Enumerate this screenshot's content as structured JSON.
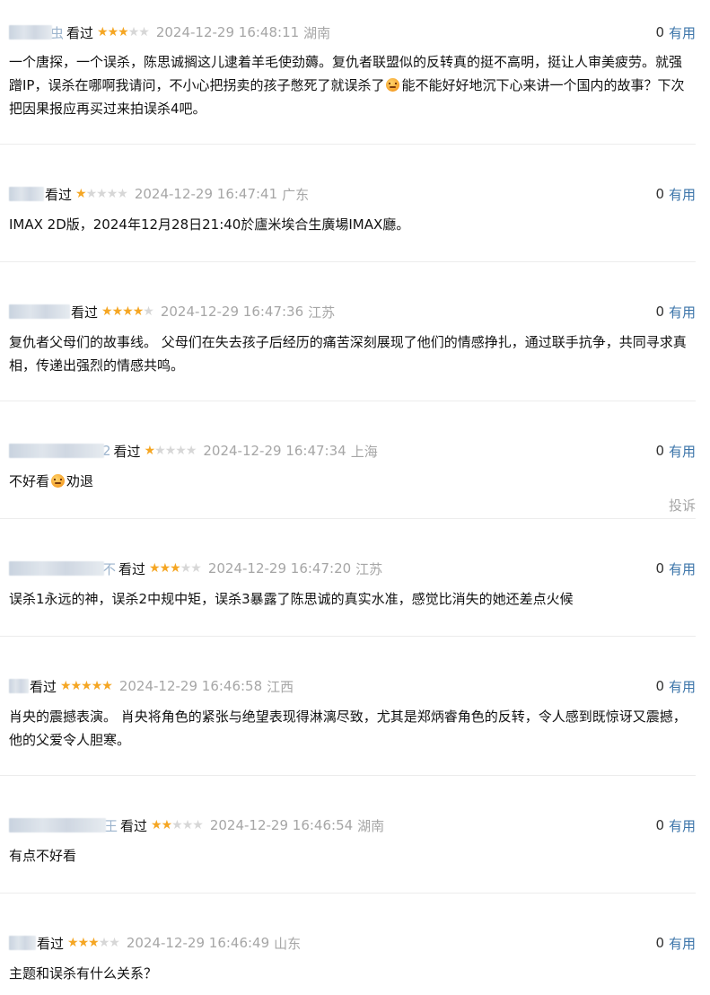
{
  "colors": {
    "star_on": "#f5a623",
    "star_off": "#d7d7d7",
    "meta_gray": "#a6a6a6",
    "link_blue": "#3b74a9",
    "divider": "#ececec"
  },
  "labels": {
    "watched": "看过",
    "useful": "有用",
    "report": "投诉"
  },
  "comments": [
    {
      "user_visible": "虫",
      "rating": 3,
      "time": "2024-12-29 16:48:11",
      "location": "湖南",
      "votes": "0",
      "text_parts": [
        "一个唐探，一个误杀，陈思诚搁这儿逮着羊毛使劲薅。复仇者联盟似的反转真的挺不高明，挺让人审美疲劳。就强蹭IP，误杀在哪啊我请问，不小心把拐卖的孩子憋死了就误杀了",
        "能不能好好地沉下心来讲一个国内的故事？下次把因果报应再买过来拍误杀4吧。"
      ]
    },
    {
      "user_visible": "",
      "rating": 1,
      "time": "2024-12-29 16:47:41",
      "location": "广东",
      "votes": "0",
      "text_parts": [
        "IMAX 2D版，2024年12月28日21:40於廬米埃合生廣場IMAX廳。"
      ]
    },
    {
      "user_visible": "",
      "rating": 4,
      "time": "2024-12-29 16:47:36",
      "location": "江苏",
      "votes": "0",
      "text_parts": [
        "复仇者父母们的故事线。 父母们在失去孩子后经历的痛苦深刻展现了他们的情感挣扎，通过联手抗争，共同寻求真相，传递出强烈的情感共鸣。"
      ]
    },
    {
      "user_visible": "2",
      "rating": 1,
      "time": "2024-12-29 16:47:34",
      "location": "上海",
      "votes": "0",
      "text_parts": [
        "不好看",
        "劝退"
      ]
    },
    {
      "user_visible": "不",
      "rating": 3,
      "time": "2024-12-29 16:47:20",
      "location": "江苏",
      "votes": "0",
      "text_parts": [
        "误杀1永远的神，误杀2中规中矩，误杀3暴露了陈思诚的真实水准，感觉比消失的她还差点火候"
      ]
    },
    {
      "user_visible": "",
      "rating": 5,
      "time": "2024-12-29 16:46:58",
      "location": "江西",
      "votes": "0",
      "text_parts": [
        "肖央的震撼表演。 肖央将角色的紧张与绝望表现得淋漓尽致，尤其是郑炳睿角色的反转，令人感到既惊讶又震撼，他的父爱令人胆寒。"
      ]
    },
    {
      "user_visible": "王",
      "rating": 2,
      "time": "2024-12-29 16:46:54",
      "location": "湖南",
      "votes": "0",
      "text_parts": [
        "有点不好看"
      ]
    },
    {
      "user_visible": "",
      "rating": 3,
      "time": "2024-12-29 16:46:49",
      "location": "山东",
      "votes": "0",
      "text_parts": [
        "主题和误杀有什么关系？"
      ]
    }
  ]
}
